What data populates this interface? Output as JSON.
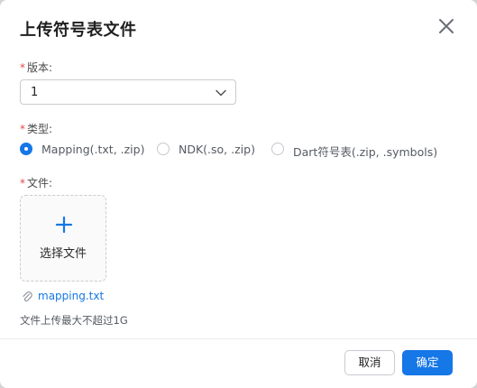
{
  "dialog": {
    "title": "上传符号表文件"
  },
  "version_field": {
    "required_mark": "*",
    "label": "版本:",
    "value": "1"
  },
  "type_field": {
    "required_mark": "*",
    "label": "类型:",
    "options": [
      {
        "label": "Mapping(.txt, .zip)",
        "checked": true
      },
      {
        "label": "NDK(.so, .zip)",
        "checked": false
      },
      {
        "label": "Dart符号表(.zip, .symbols)",
        "checked": false
      }
    ]
  },
  "file_field": {
    "required_mark": "*",
    "label": "文件:",
    "upload_label": "选择文件",
    "uploaded_file": "mapping.txt",
    "hint": "文件上传最大不超过1G"
  },
  "footer": {
    "cancel_label": "取消",
    "ok_label": "确定"
  },
  "colors": {
    "primary": "#1677e6",
    "required": "#e5484d"
  }
}
